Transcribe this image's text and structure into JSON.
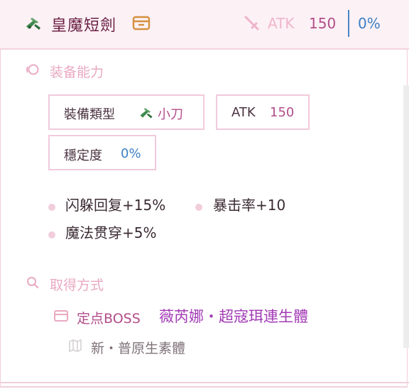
{
  "header": {
    "item_name": "皇魔短劍",
    "atk_label": "ATK",
    "atk_value": "150",
    "stability": "0%"
  },
  "abilities": {
    "section_title": "装备能力",
    "type_label": "裝備類型",
    "type_value": "小刀",
    "atk_label": "ATK",
    "atk_value": "150",
    "stability_label": "穩定度",
    "stability_value": "0%",
    "effects": [
      "闪躲回复+15%",
      "暴击率+10",
      "魔法贯穿+5%"
    ]
  },
  "acquisition": {
    "section_title": "取得方式",
    "source_type": "定点BOSS",
    "boss_name": "薇芮娜・超寇珥連生體",
    "location": "新・普原生素體"
  },
  "colors": {
    "accent_pink": "#e9a9c2",
    "stat_purple": "#b34d8a",
    "blue": "#3b7fc4",
    "link_purple": "#a23ab5"
  }
}
